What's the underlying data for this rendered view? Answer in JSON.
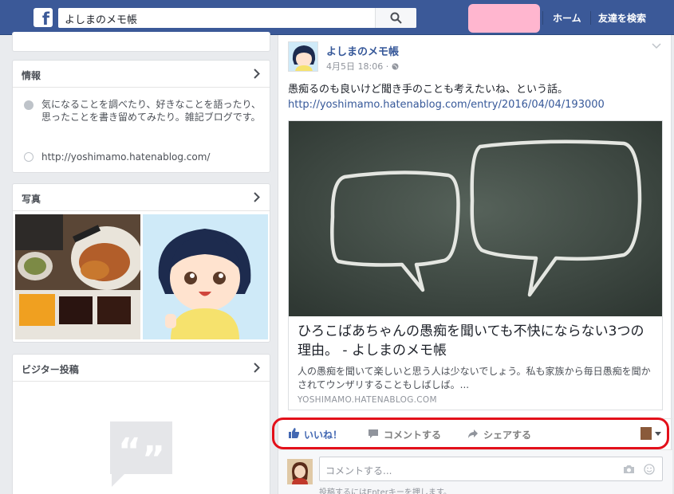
{
  "topbar": {
    "logo": "f",
    "search_value": "よしまのメモ帳",
    "search_icon": "search-icon",
    "nav_home": "ホーム",
    "nav_find_friends": "友達を検索",
    "brand_color": "#3b5998"
  },
  "sidebar": {
    "info": {
      "title": "情報",
      "description": "気になることを調べたり、好きなことを語ったり、思ったことを書き留めてみたり。雑記ブログです。",
      "website": "http://yoshimamo.hatenablog.com/"
    },
    "photos": {
      "title": "写真"
    },
    "visitor_posts": {
      "title": "ビジター投稿"
    }
  },
  "post": {
    "page_name": "よしまのメモ帳",
    "time": "4月5日 18:06 · ",
    "text": "愚痴るのも良いけど聞き手のことも考えたいね、という話。",
    "url": "http://yoshimamo.hatenablog.com/entry/2016/04/04/193000",
    "link": {
      "title": "ひろこばあちゃんの愚痴を聞いても不快にならない3つの理由。 - よしまのメモ帳",
      "description": "人の愚痴を聞いて楽しいと思う人は少ないでしょう。私も家族から毎日愚痴を聞かされてウンザリすることもしばしば。...",
      "domain": "YOSHIMAMO.HATENABLOG.COM"
    },
    "actions": {
      "like": "いいね！",
      "comment": "コメントする",
      "share": "シェアする"
    },
    "comment_placeholder": "コメントする...",
    "comment_hint": "投稿するにはEnterキーを押します。"
  }
}
